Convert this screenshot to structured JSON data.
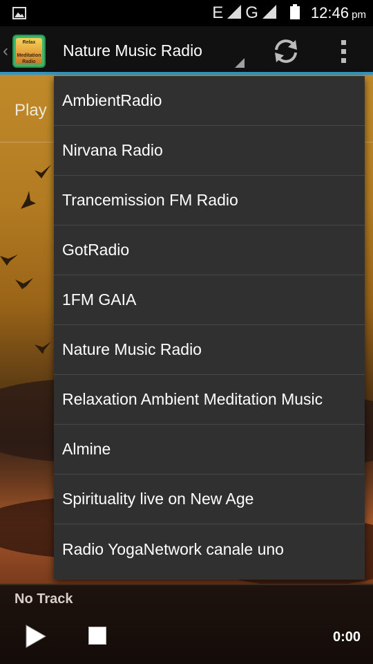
{
  "status_bar": {
    "network_e": "E",
    "network_g": "G",
    "time": "12:46",
    "ampm": "pm"
  },
  "action_bar": {
    "logo_text": [
      "Relax",
      "Meditation",
      "Radio"
    ],
    "selected_station": "Nature Music Radio"
  },
  "main": {
    "play_label": "Play"
  },
  "dropdown": {
    "items": [
      "AmbientRadio",
      "Nirvana Radio",
      "Trancemission FM Radio",
      "GotRadio",
      "1FM GAIA",
      "Nature Music Radio",
      "Relaxation Ambient Meditation Music",
      "Almine",
      "Spirituality live on New Age",
      "Radio YogaNetwork canale uno"
    ]
  },
  "player": {
    "track": "No Track",
    "time": "0:00"
  },
  "icons": {
    "gallery_notification": "image-icon",
    "signal": "signal-strength-icon",
    "battery": "battery-icon",
    "refresh": "refresh-icon",
    "overflow": "more-vertical-icon",
    "play": "play-icon",
    "stop": "stop-icon"
  },
  "colors": {
    "accent": "#2f96c8",
    "menu_bg": "#303030",
    "action_bar_bg": "#111111"
  }
}
